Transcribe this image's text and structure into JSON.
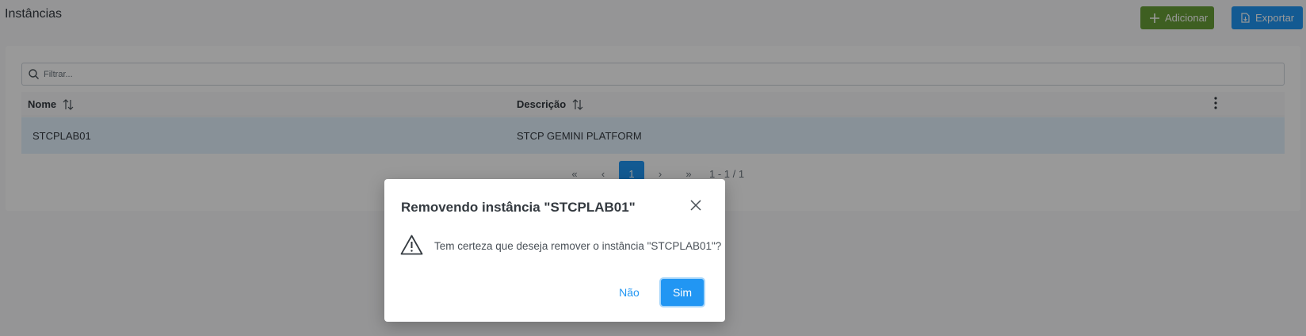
{
  "header": {
    "title": "Instâncias",
    "add_label": "Adicionar",
    "export_label": "Exportar"
  },
  "filter": {
    "placeholder": "Filtrar..."
  },
  "table": {
    "columns": [
      "Nome",
      "Descrição"
    ],
    "rows": [
      {
        "nome": "STCPLAB01",
        "descricao": "STCP GEMINI PLATFORM"
      }
    ]
  },
  "paginator": {
    "first": "«",
    "prev": "‹",
    "page": "1",
    "next": "›",
    "last": "»",
    "report": "1 - 1 / 1"
  },
  "dialog": {
    "title": "Removendo instância \"STCPLAB01\"",
    "message": "Tem certeza que deseja remover o instância \"STCPLAB01\"?",
    "no_label": "Não",
    "yes_label": "Sim"
  },
  "colors": {
    "add": "#689f38",
    "primary": "#2196f3",
    "row_selected": "#e3f2fd"
  }
}
